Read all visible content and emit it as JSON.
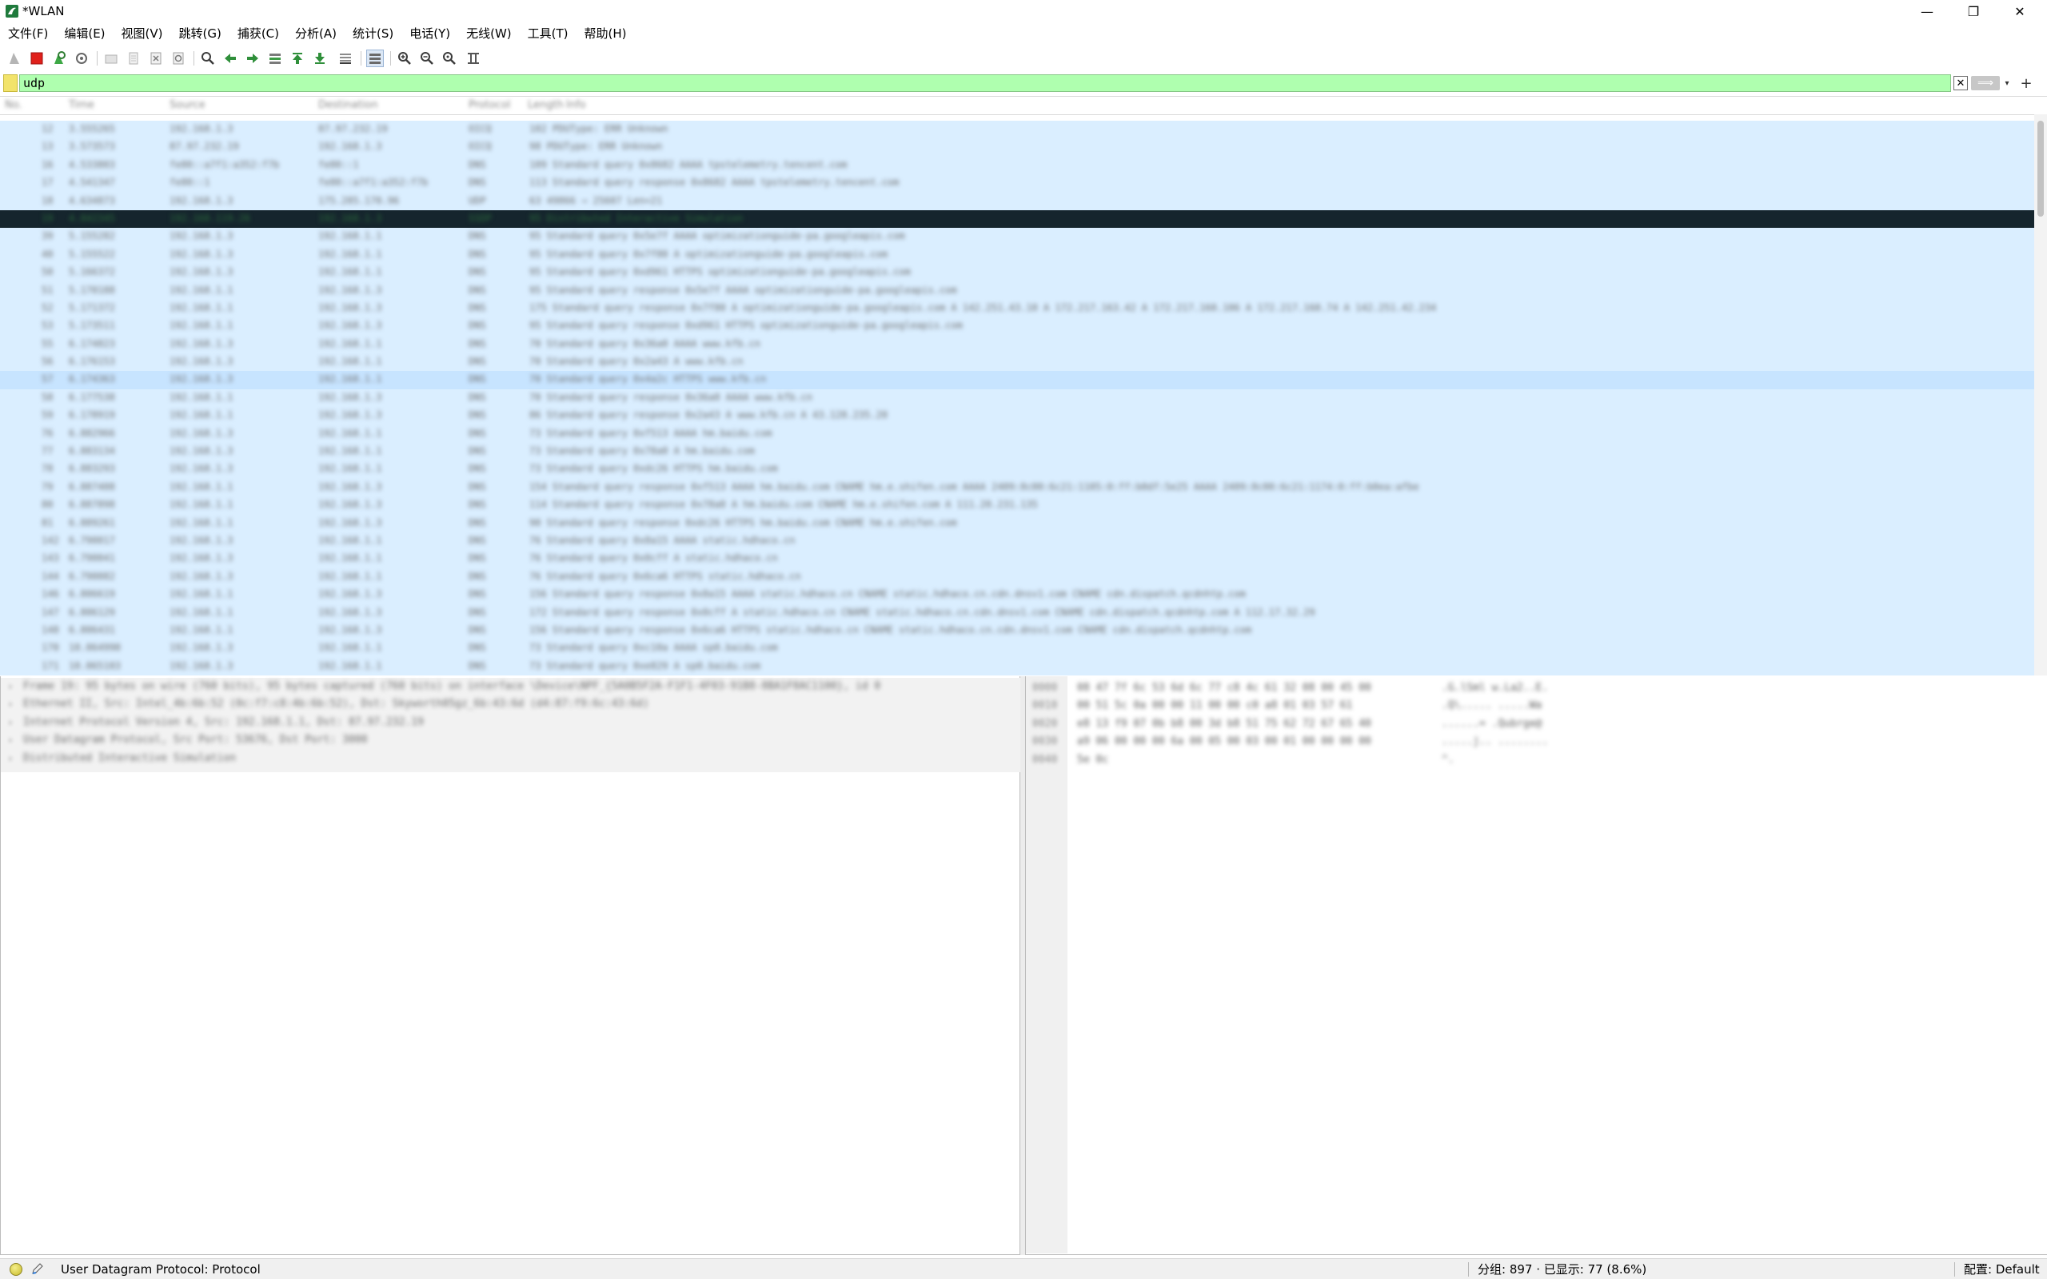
{
  "window": {
    "title": "*WLAN",
    "minimize_glyph": "—",
    "maximize_glyph": "❐",
    "close_glyph": "✕"
  },
  "menu": {
    "items": [
      {
        "label": "文件(F)"
      },
      {
        "label": "编辑(E)"
      },
      {
        "label": "视图(V)"
      },
      {
        "label": "跳转(G)"
      },
      {
        "label": "捕获(C)"
      },
      {
        "label": "分析(A)"
      },
      {
        "label": "统计(S)"
      },
      {
        "label": "电话(Y)"
      },
      {
        "label": "无线(W)"
      },
      {
        "label": "工具(T)"
      },
      {
        "label": "帮助(H)"
      }
    ]
  },
  "toolbar": {
    "icons": [
      "shark-fin-start-icon",
      "stop-capture-icon",
      "restart-capture-icon",
      "capture-options-icon",
      "open-file-icon",
      "save-file-icon",
      "close-file-icon",
      "reload-file-icon",
      "find-packet-icon",
      "go-back-icon",
      "go-forward-icon",
      "go-to-packet-icon",
      "go-first-icon",
      "go-last-icon",
      "autoscroll-icon",
      "colorize-icon",
      "zoom-in-icon",
      "zoom-out-icon",
      "zoom-reset-icon",
      "resize-columns-icon"
    ]
  },
  "filter": {
    "value": "udp",
    "clear_glyph": "✕",
    "apply_glyph": "⟹",
    "dropdown_glyph": "▾",
    "add_glyph": "+"
  },
  "packet_list": {
    "columns": [
      "No.",
      "Time",
      "Source",
      "Destination",
      "Protocol",
      "Length",
      "Info"
    ],
    "rows": [
      {
        "no": "12",
        "time": "3.555265",
        "src": "192.168.1.3",
        "dst": "87.97.232.19",
        "proto": "OICQ",
        "len": "",
        "info": "102 PDUType: ERR Unknown",
        "style": "sel-light"
      },
      {
        "no": "13",
        "time": "3.573573",
        "src": "87.97.232.19",
        "dst": "192.168.1.3",
        "proto": "OICQ",
        "len": "",
        "info": "98 PDUType: ERR Unknown",
        "style": ""
      },
      {
        "no": "16",
        "time": "4.533803",
        "src": "fe80::a7f1:a352:f7b",
        "dst": "fe80::1",
        "proto": "DNS",
        "len": "",
        "info": "109 Standard query 0x8682 AAAA tpstelemetry.tencent.com",
        "style": ""
      },
      {
        "no": "17",
        "time": "4.541347",
        "src": "fe80::1",
        "dst": "fe80::a7f1:a352:f7b",
        "proto": "DNS",
        "len": "",
        "info": "113 Standard query response 0x8682 AAAA tpstelemetry.tencent.com",
        "style": ""
      },
      {
        "no": "18",
        "time": "4.634873",
        "src": "192.168.1.3",
        "dst": "175.285.170.96",
        "proto": "UDP",
        "len": "",
        "info": "63 49866 → 25607 Len=21",
        "style": ""
      },
      {
        "no": "19",
        "time": "4.842345",
        "src": "192.168.119.26",
        "dst": "192.168.1.3",
        "proto": "SSDP",
        "len": "",
        "info": "95 Distributed Interactive Simulation",
        "style": "selected"
      },
      {
        "no": "39",
        "time": "5.155282",
        "src": "192.168.1.3",
        "dst": "192.168.1.1",
        "proto": "DNS",
        "len": "",
        "info": "95 Standard query 0x5e7f AAAA optimizationguide-pa.googleapis.com",
        "style": ""
      },
      {
        "no": "40",
        "time": "5.155522",
        "src": "192.168.1.3",
        "dst": "192.168.1.1",
        "proto": "DNS",
        "len": "",
        "info": "95 Standard query 0x7f80 A optimizationguide-pa.googleapis.com",
        "style": ""
      },
      {
        "no": "50",
        "time": "5.166372",
        "src": "192.168.1.3",
        "dst": "192.168.1.1",
        "proto": "DNS",
        "len": "",
        "info": "95 Standard query 0xd961 HTTPS optimizationguide-pa.googleapis.com",
        "style": ""
      },
      {
        "no": "51",
        "time": "5.170188",
        "src": "192.168.1.1",
        "dst": "192.168.1.3",
        "proto": "DNS",
        "len": "",
        "info": "95 Standard query response 0x5e7f AAAA optimizationguide-pa.googleapis.com",
        "style": ""
      },
      {
        "no": "52",
        "time": "5.171372",
        "src": "192.168.1.1",
        "dst": "192.168.1.3",
        "proto": "DNS",
        "len": "",
        "info": "175 Standard query response 0x7f80 A optimizationguide-pa.googleapis.com A 142.251.43.10 A 172.217.163.42 A 172.217.160.106 A 172.217.160.74 A 142.251.42.234",
        "style": ""
      },
      {
        "no": "53",
        "time": "5.173511",
        "src": "192.168.1.1",
        "dst": "192.168.1.3",
        "proto": "DNS",
        "len": "",
        "info": "95 Standard query response 0xd961 HTTPS optimizationguide-pa.googleapis.com",
        "style": ""
      },
      {
        "no": "55",
        "time": "6.174823",
        "src": "192.168.1.3",
        "dst": "192.168.1.1",
        "proto": "DNS",
        "len": "",
        "info": "70 Standard query 0x36a0 AAAA www.kfb.cn",
        "style": ""
      },
      {
        "no": "56",
        "time": "6.176153",
        "src": "192.168.1.3",
        "dst": "192.168.1.1",
        "proto": "DNS",
        "len": "",
        "info": "70 Standard query 0x2a43 A www.kfb.cn",
        "style": ""
      },
      {
        "no": "57",
        "time": "6.174363",
        "src": "192.168.1.3",
        "dst": "192.168.1.1",
        "proto": "DNS",
        "len": "",
        "info": "70 Standard query 0x4a2c HTTPS www.kfb.cn",
        "style": "alt"
      },
      {
        "no": "58",
        "time": "6.177538",
        "src": "192.168.1.1",
        "dst": "192.168.1.3",
        "proto": "DNS",
        "len": "",
        "info": "70 Standard query response 0x36a0 AAAA www.kfb.cn",
        "style": ""
      },
      {
        "no": "59",
        "time": "6.178919",
        "src": "192.168.1.1",
        "dst": "192.168.1.3",
        "proto": "DNS",
        "len": "",
        "info": "86 Standard query response 0x2a43 A www.kfb.cn A 43.128.235.20",
        "style": ""
      },
      {
        "no": "76",
        "time": "6.882966",
        "src": "192.168.1.3",
        "dst": "192.168.1.1",
        "proto": "DNS",
        "len": "",
        "info": "73 Standard query 0xf513 AAAA hm.baidu.com",
        "style": ""
      },
      {
        "no": "77",
        "time": "6.883134",
        "src": "192.168.1.3",
        "dst": "192.168.1.1",
        "proto": "DNS",
        "len": "",
        "info": "73 Standard query 0x78a0 A hm.baidu.com",
        "style": ""
      },
      {
        "no": "78",
        "time": "6.883293",
        "src": "192.168.1.3",
        "dst": "192.168.1.1",
        "proto": "DNS",
        "len": "",
        "info": "73 Standard query 0xdc26 HTTPS hm.baidu.com",
        "style": ""
      },
      {
        "no": "79",
        "time": "6.887408",
        "src": "192.168.1.1",
        "dst": "192.168.1.3",
        "proto": "DNS",
        "len": "",
        "info": "154 Standard query response 0xf513 AAAA hm.baidu.com CNAME hm.e.shifen.com AAAA 2409:8c00:6c21:1105:0:ff:b0df:5e25 AAAA 2409:8c00:6c21:1174:0:ff:b0ea:afbe",
        "style": ""
      },
      {
        "no": "80",
        "time": "6.887898",
        "src": "192.168.1.1",
        "dst": "192.168.1.3",
        "proto": "DNS",
        "len": "",
        "info": "114 Standard query response 0x78a0 A hm.baidu.com CNAME hm.e.shifen.com A 111.20.231.135",
        "style": ""
      },
      {
        "no": "81",
        "time": "6.889261",
        "src": "192.168.1.1",
        "dst": "192.168.1.3",
        "proto": "DNS",
        "len": "",
        "info": "90 Standard query response 0xdc26 HTTPS hm.baidu.com CNAME hm.e.shifen.com",
        "style": ""
      },
      {
        "no": "142",
        "time": "6.790017",
        "src": "192.168.1.3",
        "dst": "192.168.1.1",
        "proto": "DNS",
        "len": "",
        "info": "76 Standard query 0x8a15 AAAA static.hdhaco.cn",
        "style": ""
      },
      {
        "no": "143",
        "time": "6.790041",
        "src": "192.168.1.3",
        "dst": "192.168.1.1",
        "proto": "DNS",
        "len": "",
        "info": "76 Standard query 0x0cff A static.hdhaco.cn",
        "style": ""
      },
      {
        "no": "144",
        "time": "6.790082",
        "src": "192.168.1.3",
        "dst": "192.168.1.1",
        "proto": "DNS",
        "len": "",
        "info": "76 Standard query 0x6ca6 HTTPS static.hdhaco.cn",
        "style": ""
      },
      {
        "no": "146",
        "time": "6.806619",
        "src": "192.168.1.1",
        "dst": "192.168.1.3",
        "proto": "DNS",
        "len": "",
        "info": "156 Standard query response 0x8a15 AAAA static.hdhaco.cn CNAME static.hdhaco.cn.cdn.dnsv1.com CNAME cdn.dispatch.qcdnhtp.com",
        "style": ""
      },
      {
        "no": "147",
        "time": "6.806129",
        "src": "192.168.1.1",
        "dst": "192.168.1.3",
        "proto": "DNS",
        "len": "",
        "info": "172 Standard query response 0x0cff A static.hdhaco.cn CNAME static.hdhaco.cn.cdn.dnsv1.com CNAME cdn.dispatch.qcdnhtp.com A 112.17.32.29",
        "style": ""
      },
      {
        "no": "148",
        "time": "6.806431",
        "src": "192.168.1.1",
        "dst": "192.168.1.3",
        "proto": "DNS",
        "len": "",
        "info": "156 Standard query response 0x6ca6 HTTPS static.hdhaco.cn CNAME static.hdhaco.cn.cdn.dnsv1.com CNAME cdn.dispatch.qcdnhtp.com",
        "style": ""
      },
      {
        "no": "170",
        "time": "10.064990",
        "src": "192.168.1.3",
        "dst": "192.168.1.1",
        "proto": "DNS",
        "len": "",
        "info": "73 Standard query 0xc10a AAAA sp0.baidu.com",
        "style": ""
      },
      {
        "no": "171",
        "time": "10.065103",
        "src": "192.168.1.3",
        "dst": "192.168.1.1",
        "proto": "DNS",
        "len": "",
        "info": "73 Standard query 0xe829 A sp0.baidu.com",
        "style": ""
      }
    ]
  },
  "details": {
    "lines": [
      "Frame 19: 95 bytes on wire (760 bits), 95 bytes captured (760 bits) on interface \\Device\\NPF_{5A0B5F2A-F1F1-4F03-91B8-8BA1F8AC1100}, id 0",
      "Ethernet II, Src: Intel_4b:6b:52 (0c:f7:c8:4b:6b:52), Dst: Skyworth05gz_6b:43:6d (d4:87:f9:6c:43:6d)",
      "Internet Protocol Version 4, Src: 192.168.1.1, Dst: 87.97.232.19",
      "User Datagram Protocol, Src Port: 53676, Dst Port: 3000",
      "Distributed Interactive Simulation"
    ],
    "expander_glyph": "›"
  },
  "bytes": {
    "lines": [
      {
        "off": "0000",
        "hex": "08 47 7f 6c 53 6d 6c 77  c8 4c 61 32 08 00 45 00",
        "asc": ".G.lSml w.La2..E."
      },
      {
        "off": "0010",
        "hex": "00 51 5c 0a 00 00 11  00 00 c0 a8 01 03 57 61",
        "asc": ".Q\\.....  .....Wa"
      },
      {
        "off": "0020",
        "hex": "e8 13 f9 07 0b b8 00 3d  b8 51 75 62 72 67 65 40",
        "asc": "......=  .Qubrge@"
      },
      {
        "off": "0030",
        "hex": "a9 06 00 00 00 6a 00 05  00 03 00 01 00 00 00 00",
        "asc": ".....j.. ........"
      },
      {
        "off": "0040",
        "hex": "5e 0c",
        "asc": "^."
      }
    ]
  },
  "status": {
    "field_info": "User Datagram Protocol: Protocol",
    "packets": "分组: 897 · 已显示: 77 (8.6%)",
    "profile": "配置: Default"
  }
}
